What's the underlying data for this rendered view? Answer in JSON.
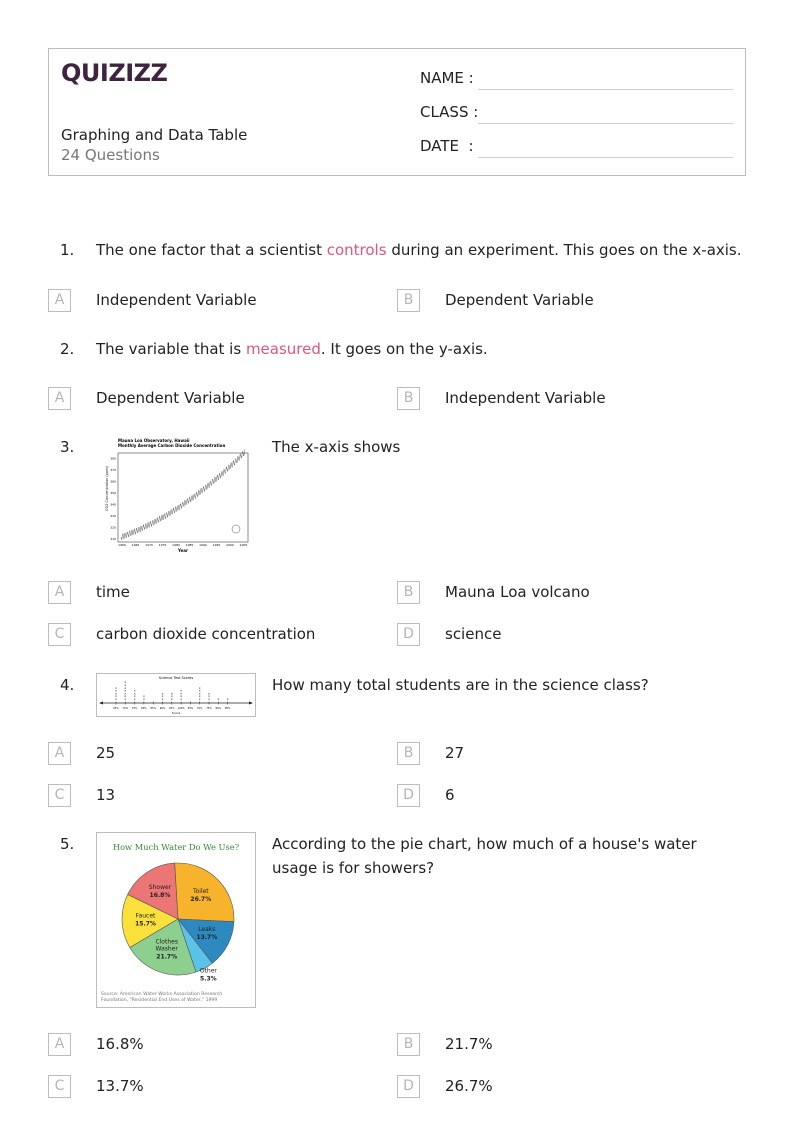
{
  "header": {
    "logo": "QUIZIZZ",
    "title": "Graphing and Data Table",
    "question_count": "24 Questions",
    "fields": [
      {
        "label": "NAME :"
      },
      {
        "label": "CLASS :"
      },
      {
        "label": "DATE  :"
      }
    ]
  },
  "colors": {
    "brand": "#3d2540",
    "highlight": "#e0557f",
    "border": "#bdbdbd"
  },
  "questions": [
    {
      "number": "1.",
      "text_before": "The one factor that a scientist ",
      "highlight": "controls",
      "text_after": " during an experiment. This goes on the x-axis.",
      "options": [
        {
          "letter": "A",
          "text": "Independent Variable"
        },
        {
          "letter": "B",
          "text": "Dependent Variable"
        }
      ]
    },
    {
      "number": "2.",
      "text_before": "The variable that is ",
      "highlight": "measured",
      "text_after": ". It goes on the y-axis.",
      "options": [
        {
          "letter": "A",
          "text": "Dependent Variable"
        },
        {
          "letter": "B",
          "text": "Independent Variable"
        }
      ]
    },
    {
      "number": "3.",
      "text": "The x-axis shows",
      "image": {
        "title_line1": "Mauna Loa Observatory, Hawaii",
        "title_line2": "Monthly Average Carbon Dioxide Concentration",
        "ylabel": "CO2 Concentration (ppm)",
        "xlabel": "Year",
        "x_ticks": [
          "1960",
          "1965",
          "1970",
          "1975",
          "1980",
          "1985",
          "1990",
          "1995",
          "2000",
          "2005"
        ],
        "y_ticks": [
          "310",
          "320",
          "330",
          "340",
          "350",
          "360",
          "370",
          "380"
        ]
      },
      "options": [
        {
          "letter": "A",
          "text": "time"
        },
        {
          "letter": "B",
          "text": "Mauna Loa volcano"
        },
        {
          "letter": "C",
          "text": "carbon dioxide concentration"
        },
        {
          "letter": "D",
          "text": "science"
        }
      ]
    },
    {
      "number": "4.",
      "text": "How many total students are in the science class?",
      "image": {
        "title": "Science Test Scores",
        "xlabel": "Score",
        "categories": [
          "65%",
          "70%",
          "75%",
          "80%",
          "85%",
          "90%",
          "95%",
          "100%",
          "65%",
          "70%",
          "75%",
          "80%",
          "85%",
          "90%"
        ],
        "counts": [
          5,
          7,
          4,
          2,
          0,
          3,
          3,
          4,
          0,
          5,
          3,
          1,
          1
        ]
      },
      "options": [
        {
          "letter": "A",
          "text": "25"
        },
        {
          "letter": "B",
          "text": "27"
        },
        {
          "letter": "C",
          "text": "13"
        },
        {
          "letter": "D",
          "text": "6"
        }
      ]
    },
    {
      "number": "5.",
      "text": "According to the pie chart, how much of a house's water usage is for showers?",
      "options": [
        {
          "letter": "A",
          "text": "16.8%"
        },
        {
          "letter": "B",
          "text": "21.7%"
        },
        {
          "letter": "C",
          "text": "13.7%"
        },
        {
          "letter": "D",
          "text": "26.7%"
        }
      ]
    }
  ],
  "chart_data": [
    {
      "type": "pie",
      "title": "How Much Water Do We Use?",
      "categories": [
        "Toilet",
        "Leaks",
        "Other",
        "Clothes Washer",
        "Faucet",
        "Shower"
      ],
      "values": [
        26.7,
        13.7,
        5.3,
        21.7,
        15.7,
        16.8
      ],
      "labels": [
        "26.7%",
        "13.7%",
        "5.3%",
        "21.7%",
        "15.7%",
        "16.8%"
      ],
      "colors": [
        "#f7b32b",
        "#2c8ac0",
        "#5cc3e8",
        "#8dcf8f",
        "#f9e03a",
        "#ec7575"
      ],
      "source": "Source: American Water Works Association Research Foundation, \"Residential End Uses of Water,\" 1999"
    }
  ]
}
